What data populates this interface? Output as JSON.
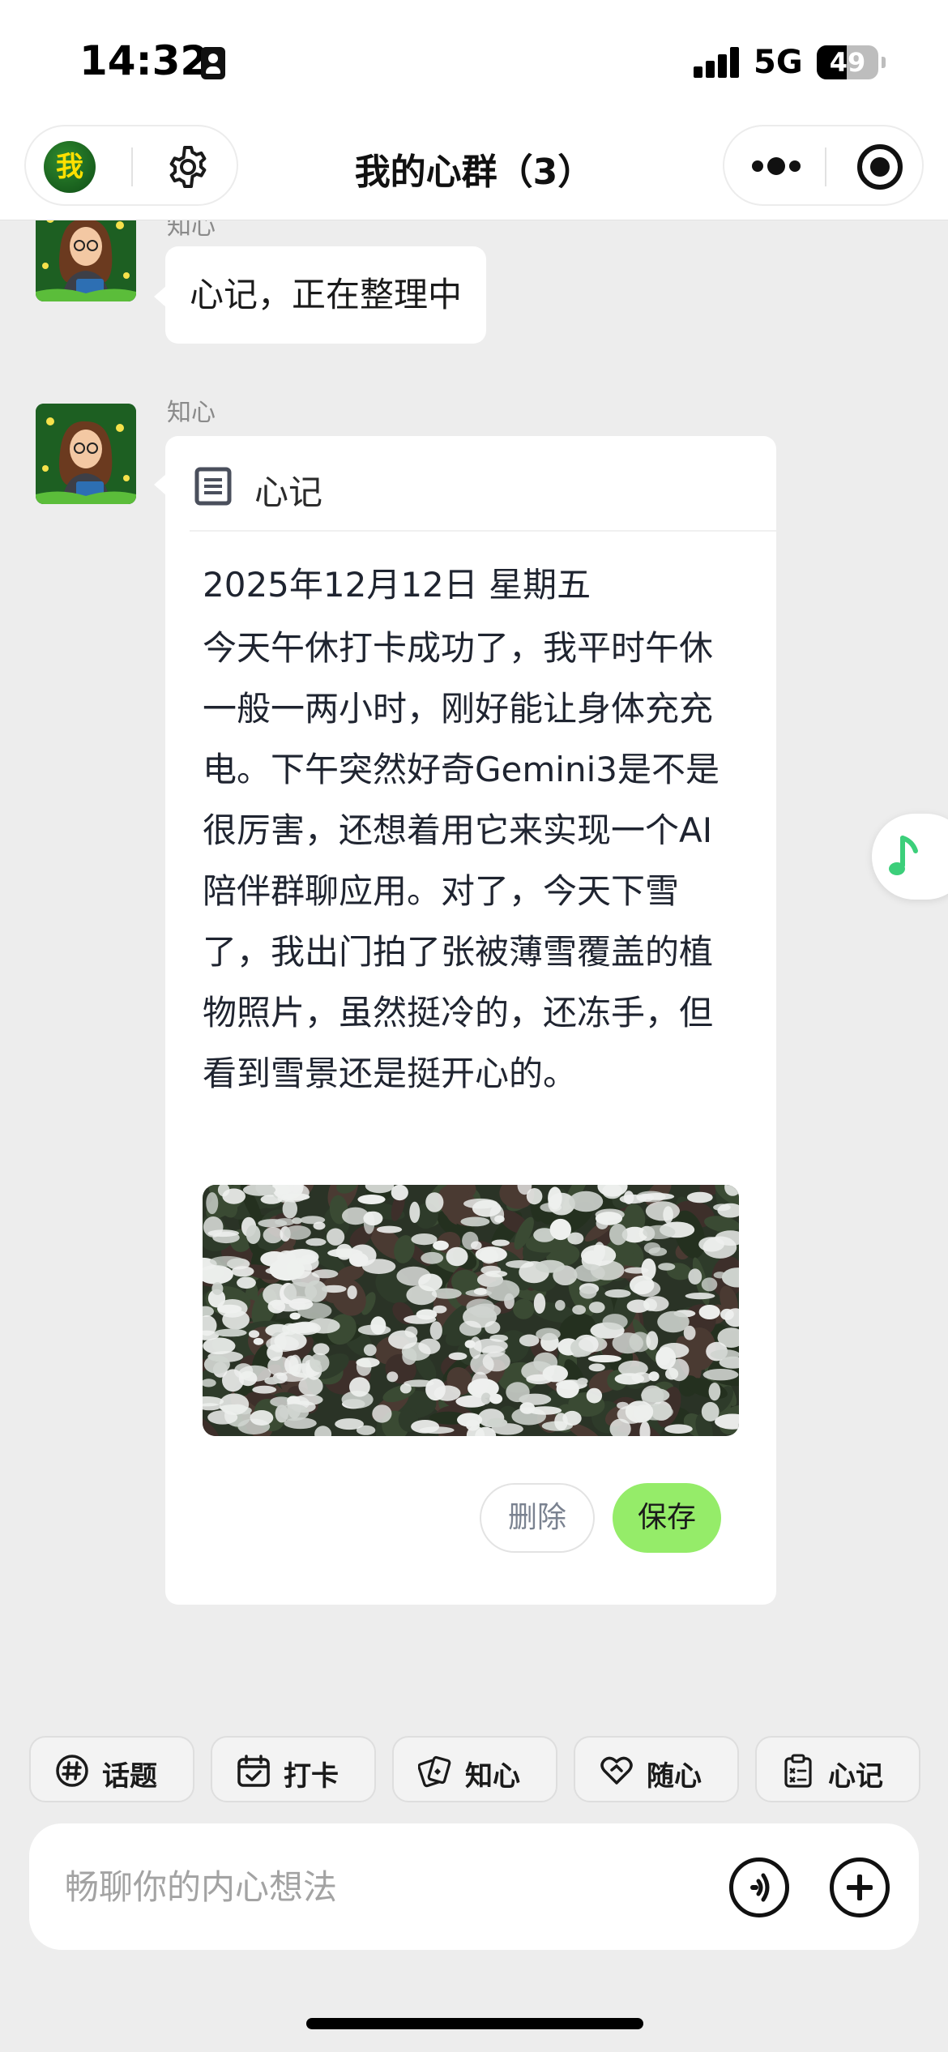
{
  "status_bar": {
    "time": "14:32",
    "network": "5G",
    "battery_level": "49",
    "battery_fraction": 0.49
  },
  "header": {
    "me_avatar_label": "我",
    "title": "我的心群（3）"
  },
  "messages": [
    {
      "sender": "知心",
      "text": "心记，正在整理中"
    }
  ],
  "note_card": {
    "sender": "知心",
    "title": "心记",
    "date": "2025年12月12日 星期五",
    "body": "今天午休打卡成功了，我平时午休一般一两小时，刚好能让身体充充电。下午突然好奇Gemini3是不是很厉害，还想着用它来实现一个AI陪伴群聊应用。对了，今天下雪了，我出门拍了张被薄雪覆盖的植物照片，虽然挺冷的，还冻手，但看到雪景还是挺开心的。",
    "delete_label": "删除",
    "save_label": "保存"
  },
  "quick_actions": [
    {
      "label": "话题",
      "icon": "hashtag-icon"
    },
    {
      "label": "打卡",
      "icon": "calendar-check-icon"
    },
    {
      "label": "知心",
      "icon": "cards-icon"
    },
    {
      "label": "随心",
      "icon": "heart-icon"
    },
    {
      "label": "心记",
      "icon": "clipboard-icon"
    }
  ],
  "input": {
    "placeholder": "畅聊你的内心想法"
  },
  "colors": {
    "background": "#ededed",
    "save_button": "#95ec69",
    "music_icon": "#3ccf7a"
  }
}
